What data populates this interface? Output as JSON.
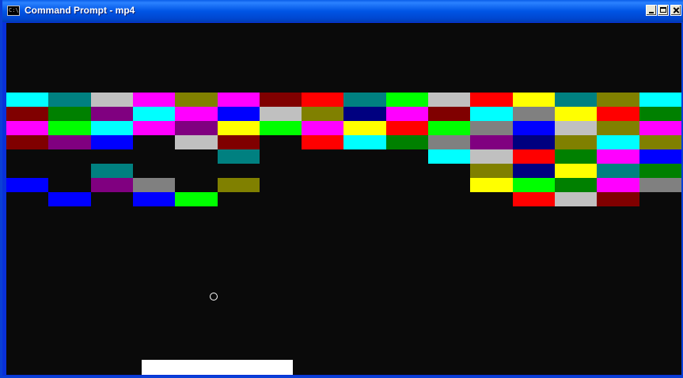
{
  "window": {
    "title": "Command Prompt - mp4",
    "icon": "cmd-icon",
    "icon_text": "C:\\"
  },
  "game": {
    "ball_icon": "ball-circle",
    "bricks": [
      {
        "row": 0,
        "col": 0,
        "color": "#00ffff"
      },
      {
        "row": 0,
        "col": 1,
        "color": "#008080"
      },
      {
        "row": 0,
        "col": 2,
        "color": "#c0c0c0"
      },
      {
        "row": 0,
        "col": 3,
        "color": "#ff00ff"
      },
      {
        "row": 0,
        "col": 4,
        "color": "#808000"
      },
      {
        "row": 0,
        "col": 5,
        "color": "#ff00ff"
      },
      {
        "row": 0,
        "col": 6,
        "color": "#800000"
      },
      {
        "row": 0,
        "col": 7,
        "color": "#ff0000"
      },
      {
        "row": 0,
        "col": 8,
        "color": "#008080"
      },
      {
        "row": 0,
        "col": 9,
        "color": "#00ff00"
      },
      {
        "row": 0,
        "col": 10,
        "color": "#c0c0c0"
      },
      {
        "row": 0,
        "col": 11,
        "color": "#ff0000"
      },
      {
        "row": 0,
        "col": 12,
        "color": "#ffff00"
      },
      {
        "row": 0,
        "col": 13,
        "color": "#008080"
      },
      {
        "row": 0,
        "col": 14,
        "color": "#808000"
      },
      {
        "row": 0,
        "col": 15,
        "color": "#00ffff"
      },
      {
        "row": 1,
        "col": 0,
        "color": "#800000"
      },
      {
        "row": 1,
        "col": 1,
        "color": "#008000"
      },
      {
        "row": 1,
        "col": 2,
        "color": "#800080"
      },
      {
        "row": 1,
        "col": 3,
        "color": "#00ffff"
      },
      {
        "row": 1,
        "col": 4,
        "color": "#ff00ff"
      },
      {
        "row": 1,
        "col": 5,
        "color": "#0000ff"
      },
      {
        "row": 1,
        "col": 6,
        "color": "#c0c0c0"
      },
      {
        "row": 1,
        "col": 7,
        "color": "#808000"
      },
      {
        "row": 1,
        "col": 8,
        "color": "#000080"
      },
      {
        "row": 1,
        "col": 9,
        "color": "#ff00ff"
      },
      {
        "row": 1,
        "col": 10,
        "color": "#800000"
      },
      {
        "row": 1,
        "col": 11,
        "color": "#00ffff"
      },
      {
        "row": 1,
        "col": 12,
        "color": "#808080"
      },
      {
        "row": 1,
        "col": 13,
        "color": "#ffff00"
      },
      {
        "row": 1,
        "col": 14,
        "color": "#ff0000"
      },
      {
        "row": 1,
        "col": 15,
        "color": "#008000"
      },
      {
        "row": 2,
        "col": 0,
        "color": "#ff00ff"
      },
      {
        "row": 2,
        "col": 1,
        "color": "#00ff00"
      },
      {
        "row": 2,
        "col": 2,
        "color": "#00ffff"
      },
      {
        "row": 2,
        "col": 3,
        "color": "#ff00ff"
      },
      {
        "row": 2,
        "col": 4,
        "color": "#800080"
      },
      {
        "row": 2,
        "col": 5,
        "color": "#ffff00"
      },
      {
        "row": 2,
        "col": 6,
        "color": "#00ff00"
      },
      {
        "row": 2,
        "col": 7,
        "color": "#ff00ff"
      },
      {
        "row": 2,
        "col": 8,
        "color": "#ffff00"
      },
      {
        "row": 2,
        "col": 9,
        "color": "#ff0000"
      },
      {
        "row": 2,
        "col": 10,
        "color": "#00ff00"
      },
      {
        "row": 2,
        "col": 11,
        "color": "#808080"
      },
      {
        "row": 2,
        "col": 12,
        "color": "#0000ff"
      },
      {
        "row": 2,
        "col": 13,
        "color": "#c0c0c0"
      },
      {
        "row": 2,
        "col": 14,
        "color": "#808000"
      },
      {
        "row": 2,
        "col": 15,
        "color": "#ff00ff"
      },
      {
        "row": 3,
        "col": 0,
        "color": "#800000"
      },
      {
        "row": 3,
        "col": 1,
        "color": "#800080"
      },
      {
        "row": 3,
        "col": 2,
        "color": "#0000ff"
      },
      {
        "row": 3,
        "col": 4,
        "color": "#c0c0c0"
      },
      {
        "row": 3,
        "col": 5,
        "color": "#800000"
      },
      {
        "row": 3,
        "col": 7,
        "color": "#ff0000"
      },
      {
        "row": 3,
        "col": 8,
        "color": "#00ffff"
      },
      {
        "row": 3,
        "col": 9,
        "color": "#008000"
      },
      {
        "row": 3,
        "col": 10,
        "color": "#808080"
      },
      {
        "row": 3,
        "col": 11,
        "color": "#800080"
      },
      {
        "row": 3,
        "col": 12,
        "color": "#000080"
      },
      {
        "row": 3,
        "col": 13,
        "color": "#808000"
      },
      {
        "row": 3,
        "col": 14,
        "color": "#00ffff"
      },
      {
        "row": 3,
        "col": 15,
        "color": "#808000"
      },
      {
        "row": 4,
        "col": 5,
        "color": "#008080"
      },
      {
        "row": 4,
        "col": 10,
        "color": "#00ffff"
      },
      {
        "row": 4,
        "col": 11,
        "color": "#c0c0c0"
      },
      {
        "row": 4,
        "col": 12,
        "color": "#ff0000"
      },
      {
        "row": 4,
        "col": 13,
        "color": "#008000"
      },
      {
        "row": 4,
        "col": 14,
        "color": "#ff00ff"
      },
      {
        "row": 4,
        "col": 15,
        "color": "#0000ff"
      },
      {
        "row": 5,
        "col": 2,
        "color": "#008080"
      },
      {
        "row": 5,
        "col": 11,
        "color": "#808000"
      },
      {
        "row": 5,
        "col": 12,
        "color": "#000080"
      },
      {
        "row": 5,
        "col": 13,
        "color": "#ffff00"
      },
      {
        "row": 5,
        "col": 14,
        "color": "#008080"
      },
      {
        "row": 5,
        "col": 15,
        "color": "#008000"
      },
      {
        "row": 6,
        "col": 0,
        "color": "#0000ff"
      },
      {
        "row": 6,
        "col": 2,
        "color": "#800080"
      },
      {
        "row": 6,
        "col": 3,
        "color": "#808080"
      },
      {
        "row": 6,
        "col": 5,
        "color": "#808000"
      },
      {
        "row": 6,
        "col": 11,
        "color": "#ffff00"
      },
      {
        "row": 6,
        "col": 12,
        "color": "#00ff00"
      },
      {
        "row": 6,
        "col": 13,
        "color": "#008000"
      },
      {
        "row": 6,
        "col": 14,
        "color": "#ff00ff"
      },
      {
        "row": 6,
        "col": 15,
        "color": "#808080"
      },
      {
        "row": 7,
        "col": 1,
        "color": "#0000ff"
      },
      {
        "row": 7,
        "col": 3,
        "color": "#0000ff"
      },
      {
        "row": 7,
        "col": 4,
        "color": "#00ff00"
      },
      {
        "row": 7,
        "col": 12,
        "color": "#ff0000"
      },
      {
        "row": 7,
        "col": 13,
        "color": "#c0c0c0"
      },
      {
        "row": 7,
        "col": 14,
        "color": "#800000"
      }
    ]
  }
}
